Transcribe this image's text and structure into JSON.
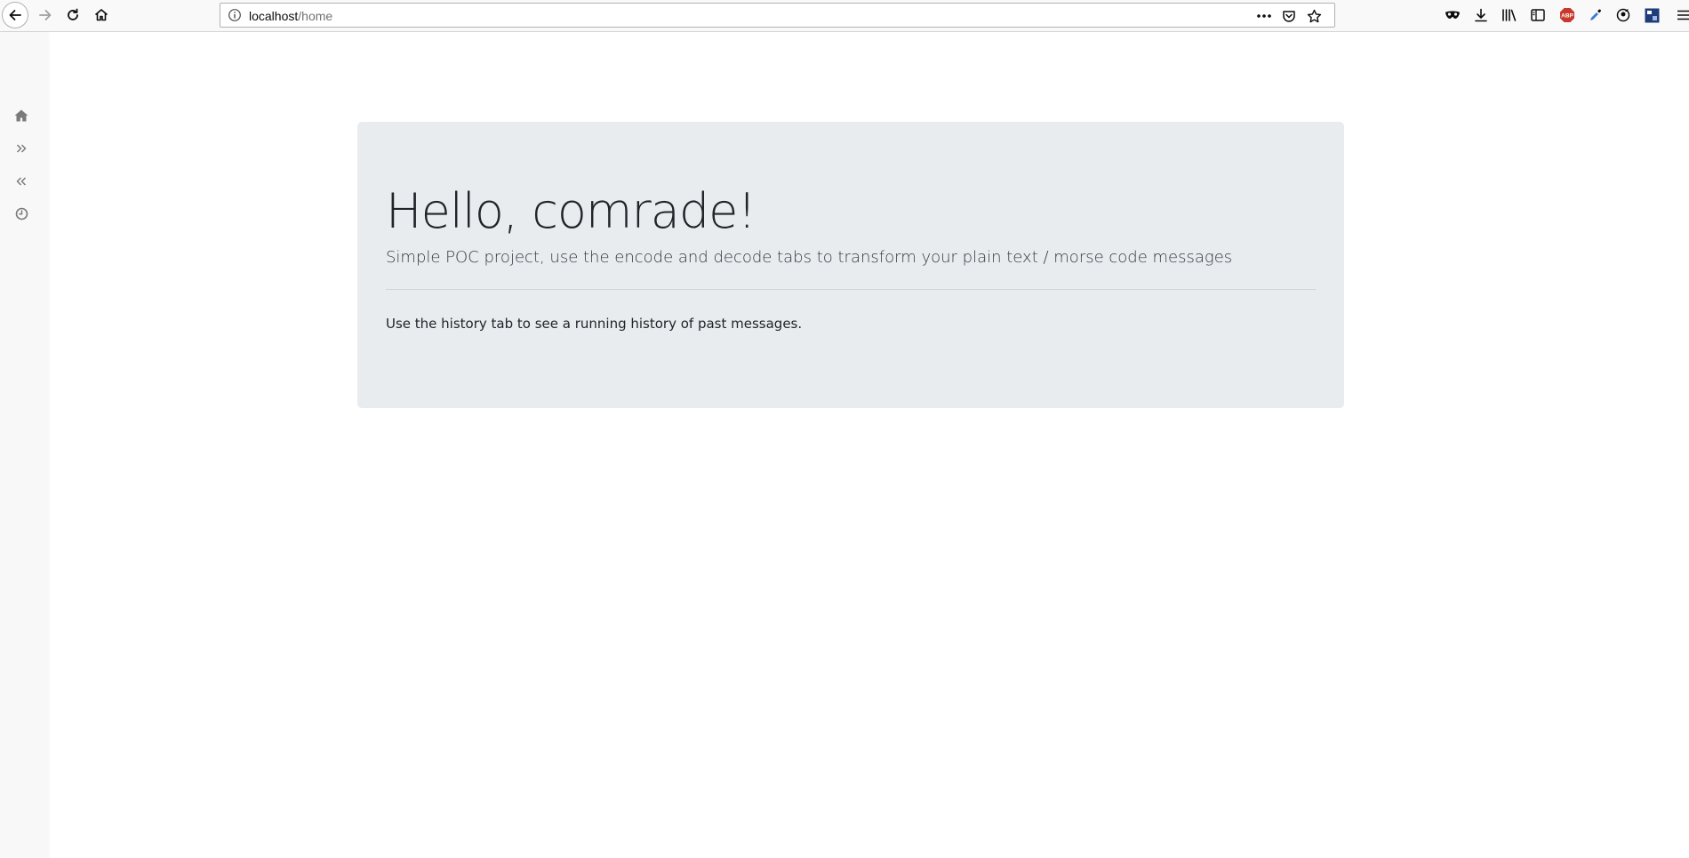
{
  "browser": {
    "url_host": "localhost",
    "url_path": "/home",
    "abp_badge": "ABP",
    "toolbar_icons": [
      "back-icon",
      "forward-icon",
      "reload-icon",
      "home-icon",
      "page-info-icon",
      "page-actions-icon",
      "pocket-icon",
      "bookmark-star-icon",
      "private-mask-icon",
      "download-icon",
      "library-icon",
      "sidebar-icon",
      "adblock-plus-icon",
      "eyedropper-icon",
      "account-icon",
      "extension-icon",
      "menu-icon"
    ]
  },
  "sidenav": {
    "items": [
      {
        "icon": "home-icon"
      },
      {
        "icon": "double-chevron-right-icon"
      },
      {
        "icon": "double-chevron-left-icon"
      },
      {
        "icon": "clock-icon"
      }
    ]
  },
  "main": {
    "title": "Hello, comrade!",
    "lead": "Simple POC project, use the encode and decode tabs to transform your plain text / morse code messages",
    "body": "Use the history tab to see a running history of past messages."
  },
  "colors": {
    "jumbotron_bg": "#e9ecef",
    "sidenav_bg": "#f8f8f8",
    "text": "#212529"
  }
}
